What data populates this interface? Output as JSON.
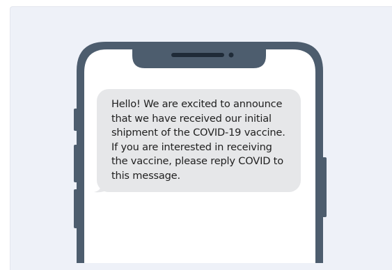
{
  "message": {
    "lines": [
      "Hello! We are excited to announce",
      "that we have received our initial",
      "shipment of the COVID-19 vaccine.",
      "If you are interested in receiving",
      "the vaccine, please reply COVID to",
      "this message."
    ]
  },
  "colors": {
    "background": "#eef1f8",
    "phone_frame": "#4d5d6e",
    "screen": "#ffffff",
    "bubble": "#e6e7e9",
    "text": "#1f1f1f"
  },
  "icons": {
    "speaker": "speaker-grille-icon",
    "camera": "front-camera-icon"
  }
}
